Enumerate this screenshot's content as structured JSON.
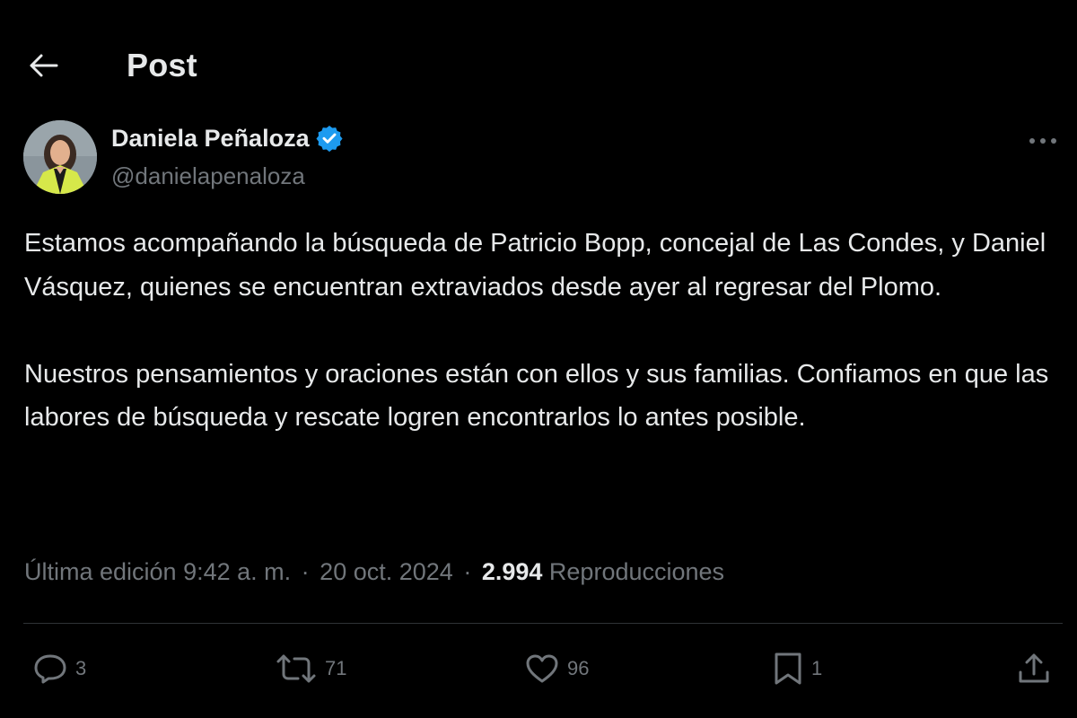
{
  "header": {
    "title": "Post"
  },
  "author": {
    "display_name": "Daniela Peñaloza",
    "handle": "@danielapenaloza",
    "verified_color": "#1d9bf0"
  },
  "tweet": {
    "paragraphs": [
      "Estamos acompañando la búsqueda de Patricio Bopp, concejal de Las Condes, y Daniel Vásquez, quienes se encuentran extraviados desde ayer al regresar del Plomo.",
      "Nuestros pensamientos y oraciones están con ellos y sus familias. Confiamos en que las labores de búsqueda y rescate logren encontrarlos lo antes posible."
    ]
  },
  "meta": {
    "edited_time": "Última edición 9:42 a. m.",
    "separator": "·",
    "date": "20 oct. 2024",
    "views_count": "2.994",
    "views_label": "Reproducciones"
  },
  "actions": {
    "replies": "3",
    "reposts": "71",
    "likes": "96",
    "bookmarks": "1"
  },
  "icons": {
    "back": "arrow-left-icon",
    "verified": "verified-badge-icon",
    "more": "more-horizontal-icon",
    "reply": "reply-icon",
    "repost": "repost-icon",
    "like": "heart-icon",
    "bookmark": "bookmark-icon",
    "share": "share-icon"
  }
}
